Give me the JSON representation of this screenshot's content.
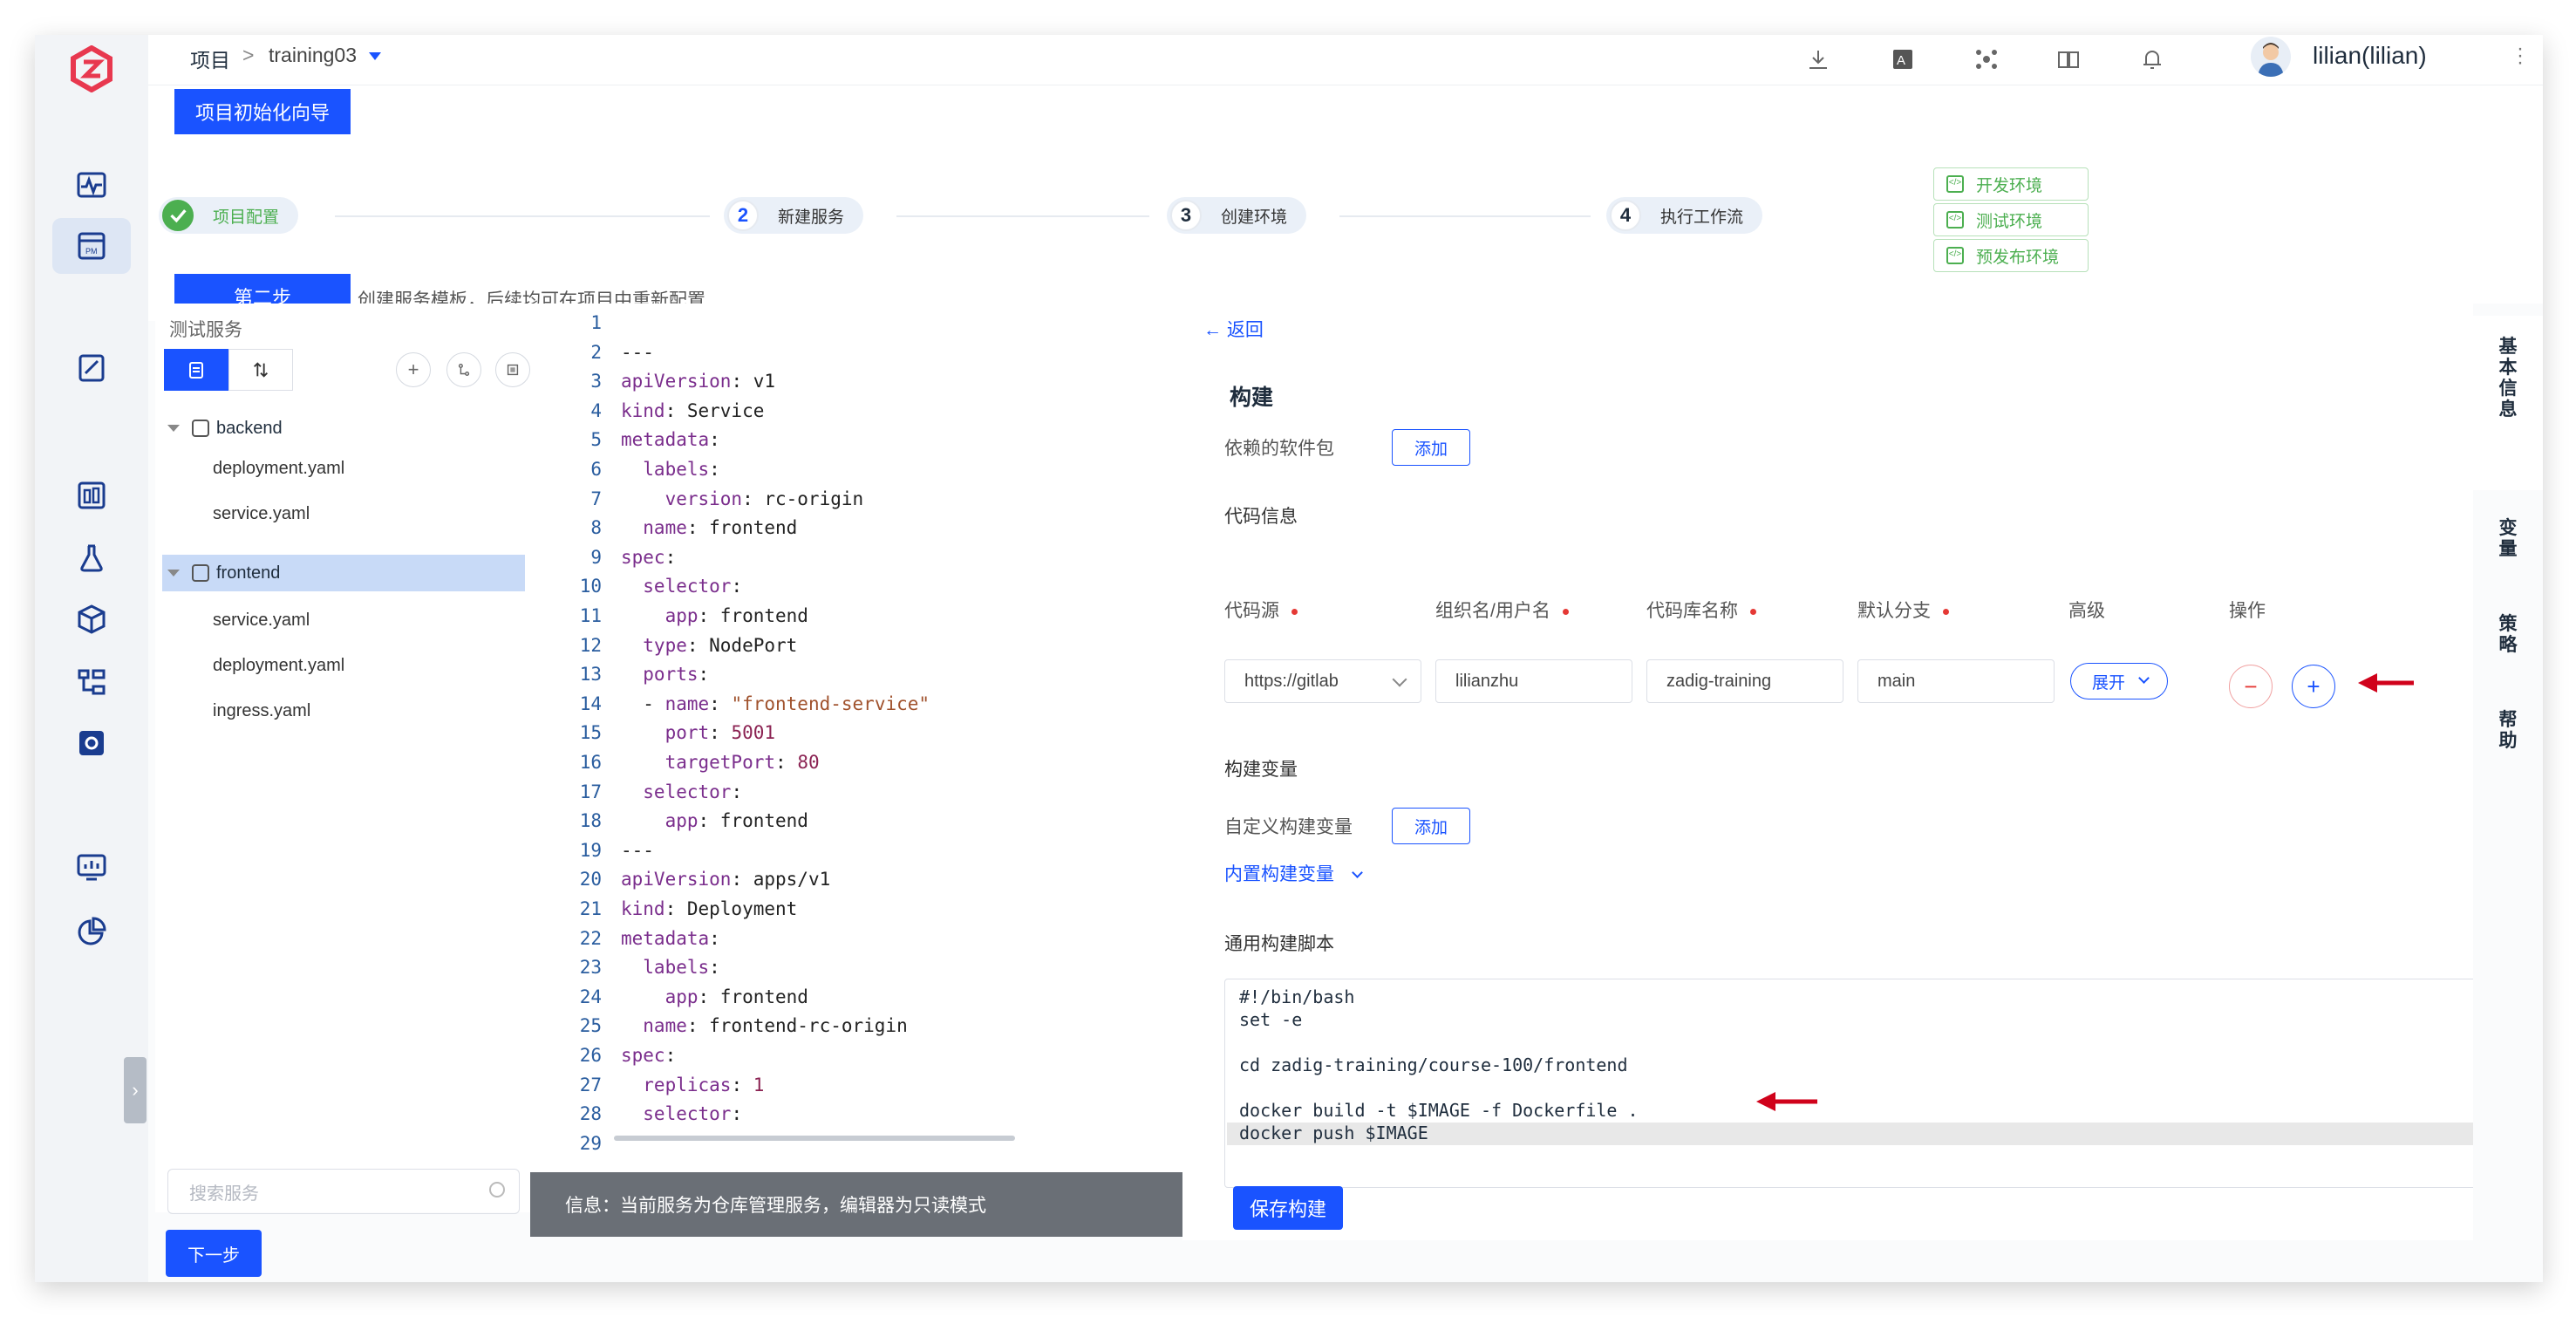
{
  "header": {
    "breadcrumb_root": "项目",
    "breadcrumb_sep": ">",
    "project_name": "training03",
    "user_name": "lilian(lilian)"
  },
  "wizard": {
    "init_button": "项目初始化向导",
    "steps": [
      {
        "num": "",
        "label": "项目配置",
        "status": "done"
      },
      {
        "num": "2",
        "label": "新建服务",
        "status": "current"
      },
      {
        "num": "3",
        "label": "创建环境",
        "status": "todo"
      },
      {
        "num": "4",
        "label": "执行工作流",
        "status": "todo"
      }
    ],
    "envs": [
      "开发环境",
      "测试环境",
      "预发布环境"
    ],
    "step_tab": "第二步",
    "step_desc": "创建服务模板，后续均可在项目中重新配置"
  },
  "tree": {
    "title": "测试服务",
    "services": [
      {
        "name": "backend",
        "files": [
          "deployment.yaml",
          "service.yaml"
        ]
      },
      {
        "name": "frontend",
        "files": [
          "service.yaml",
          "deployment.yaml",
          "ingress.yaml"
        ]
      }
    ],
    "search_placeholder": "搜索服务"
  },
  "editor": {
    "lines": [
      {
        "n": "1",
        "t": [
          [
            "",
            "p"
          ]
        ]
      },
      {
        "n": "2",
        "t": [
          [
            "---",
            "p"
          ]
        ]
      },
      {
        "n": "3",
        "t": [
          [
            "apiVersion",
            "k"
          ],
          [
            ": v1",
            "v"
          ]
        ]
      },
      {
        "n": "4",
        "t": [
          [
            "kind",
            "k"
          ],
          [
            ": Service",
            "v"
          ]
        ]
      },
      {
        "n": "5",
        "t": [
          [
            "metadata",
            "k"
          ],
          [
            ":",
            "v"
          ]
        ]
      },
      {
        "n": "6",
        "t": [
          [
            "  labels",
            "k"
          ],
          [
            ":",
            "v"
          ]
        ]
      },
      {
        "n": "7",
        "t": [
          [
            "    version",
            "k"
          ],
          [
            ": rc-origin",
            "v"
          ]
        ]
      },
      {
        "n": "8",
        "t": [
          [
            "  name",
            "k"
          ],
          [
            ": frontend",
            "v"
          ]
        ]
      },
      {
        "n": "9",
        "t": [
          [
            "spec",
            "k"
          ],
          [
            ":",
            "v"
          ]
        ]
      },
      {
        "n": "10",
        "t": [
          [
            "  selector",
            "k"
          ],
          [
            ":",
            "v"
          ]
        ]
      },
      {
        "n": "11",
        "t": [
          [
            "    app",
            "k"
          ],
          [
            ": frontend",
            "v"
          ]
        ]
      },
      {
        "n": "12",
        "t": [
          [
            "  type",
            "k"
          ],
          [
            ": NodePort",
            "v"
          ]
        ]
      },
      {
        "n": "13",
        "t": [
          [
            "  ports",
            "k"
          ],
          [
            ":",
            "v"
          ]
        ]
      },
      {
        "n": "14",
        "t": [
          [
            "  - ",
            "v"
          ],
          [
            "name",
            "k"
          ],
          [
            ": ",
            "v"
          ],
          [
            "\"frontend-service\"",
            "s"
          ]
        ]
      },
      {
        "n": "15",
        "t": [
          [
            "    port",
            "k"
          ],
          [
            ": ",
            "v"
          ],
          [
            "5001",
            "n"
          ]
        ]
      },
      {
        "n": "16",
        "t": [
          [
            "    targetPort",
            "k"
          ],
          [
            ": ",
            "v"
          ],
          [
            "80",
            "n"
          ]
        ]
      },
      {
        "n": "17",
        "t": [
          [
            "  selector",
            "k"
          ],
          [
            ":",
            "v"
          ]
        ]
      },
      {
        "n": "18",
        "t": [
          [
            "    app",
            "k"
          ],
          [
            ": frontend",
            "v"
          ]
        ]
      },
      {
        "n": "19",
        "t": [
          [
            "---",
            "p"
          ]
        ]
      },
      {
        "n": "20",
        "t": [
          [
            "apiVersion",
            "k"
          ],
          [
            ": apps/v1",
            "v"
          ]
        ]
      },
      {
        "n": "21",
        "t": [
          [
            "kind",
            "k"
          ],
          [
            ": Deployment",
            "v"
          ]
        ]
      },
      {
        "n": "22",
        "t": [
          [
            "metadata",
            "k"
          ],
          [
            ":",
            "v"
          ]
        ]
      },
      {
        "n": "23",
        "t": [
          [
            "  labels",
            "k"
          ],
          [
            ":",
            "v"
          ]
        ]
      },
      {
        "n": "24",
        "t": [
          [
            "    app",
            "k"
          ],
          [
            ": frontend",
            "v"
          ]
        ]
      },
      {
        "n": "25",
        "t": [
          [
            "  name",
            "k"
          ],
          [
            ": frontend-rc-origin",
            "v"
          ]
        ]
      },
      {
        "n": "26",
        "t": [
          [
            "spec",
            "k"
          ],
          [
            ":",
            "v"
          ]
        ]
      },
      {
        "n": "27",
        "t": [
          [
            "  replicas",
            "k"
          ],
          [
            ": ",
            "v"
          ],
          [
            "1",
            "n"
          ]
        ]
      },
      {
        "n": "28",
        "t": [
          [
            "  selector",
            "k"
          ],
          [
            ":",
            "v"
          ]
        ]
      },
      {
        "n": "29",
        "t": [
          [
            "",
            "p"
          ]
        ]
      }
    ],
    "info": "信息：当前服务为仓库管理服务，编辑器为只读模式"
  },
  "build": {
    "back": "返回",
    "title": "构建",
    "deps_label": "依赖的软件包",
    "add_label": "添加",
    "code_info": "代码信息",
    "cols": {
      "source": "代码源",
      "org": "组织名/用户名",
      "repo": "代码库名称",
      "branch": "默认分支",
      "advanced": "高级",
      "ops": "操作"
    },
    "row": {
      "source": "https://gitlab",
      "org": "lilianzhu",
      "repo": "zadig-training",
      "branch": "main",
      "expand": "展开"
    },
    "vars_title": "构建变量",
    "custom_vars": "自定义构建变量",
    "builtin_vars": "内置构建变量",
    "script_title": "通用构建脚本",
    "script": [
      "#!/bin/bash",
      "set -e",
      "",
      "cd zadig-training/course-100/frontend",
      "",
      "docker build -t $IMAGE -f Dockerfile .",
      "docker push $IMAGE"
    ],
    "save": "保存构建"
  },
  "sidetabs": [
    "基本信息",
    "变量",
    "策略",
    "帮助"
  ],
  "footer": {
    "next": "下一步"
  },
  "colors": {
    "primary": "#1a53ff",
    "success": "#4caf50",
    "danger": "#e53935",
    "rail": "#f2f4f7"
  }
}
